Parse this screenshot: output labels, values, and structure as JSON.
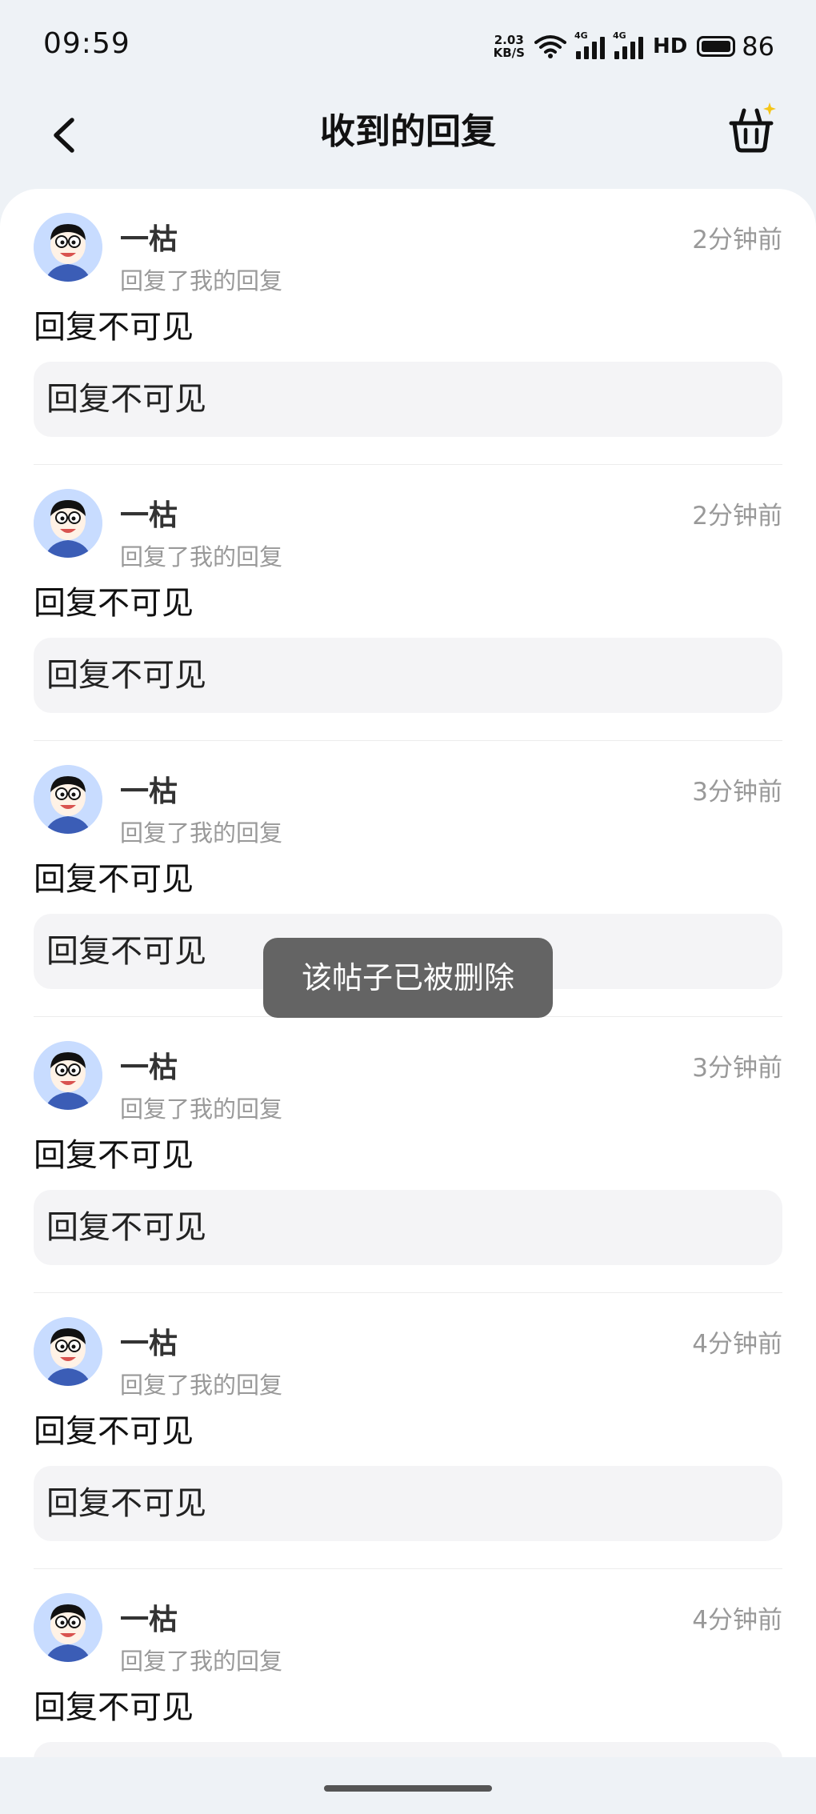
{
  "status_bar": {
    "time": "09:59",
    "net_speed_value": "2.03",
    "net_speed_unit": "KB/S",
    "signal_label_1": "4G",
    "signal_label_2": "4G",
    "hd_label": "HD",
    "battery_level": "86"
  },
  "header": {
    "title": "收到的回复"
  },
  "replies": [
    {
      "username": "一枯",
      "action": "回复了我的回复",
      "time_ago": "2分钟前",
      "text": "回复不可见",
      "quoted": "回复不可见"
    },
    {
      "username": "一枯",
      "action": "回复了我的回复",
      "time_ago": "2分钟前",
      "text": "回复不可见",
      "quoted": "回复不可见"
    },
    {
      "username": "一枯",
      "action": "回复了我的回复",
      "time_ago": "3分钟前",
      "text": "回复不可见",
      "quoted": "回复不可见"
    },
    {
      "username": "一枯",
      "action": "回复了我的回复",
      "time_ago": "3分钟前",
      "text": "回复不可见",
      "quoted": "回复不可见"
    },
    {
      "username": "一枯",
      "action": "回复了我的回复",
      "time_ago": "4分钟前",
      "text": "回复不可见",
      "quoted": "回复不可见"
    },
    {
      "username": "一枯",
      "action": "回复了我的回复",
      "time_ago": "4分钟前",
      "text": "回复不可见",
      "quoted": ""
    }
  ],
  "toast": {
    "message": "该帖子已被删除"
  },
  "colors": {
    "page_background": "#eef2f6",
    "card_background": "#ffffff",
    "quote_background": "#f4f4f6",
    "muted_text": "#999999",
    "toast_background": "#5a5a5a",
    "badge_star": "#f5c518"
  },
  "icons": [
    "back-arrow-icon",
    "basket-icon",
    "avatar-icon",
    "wifi-icon",
    "signal-icon",
    "battery-icon"
  ]
}
